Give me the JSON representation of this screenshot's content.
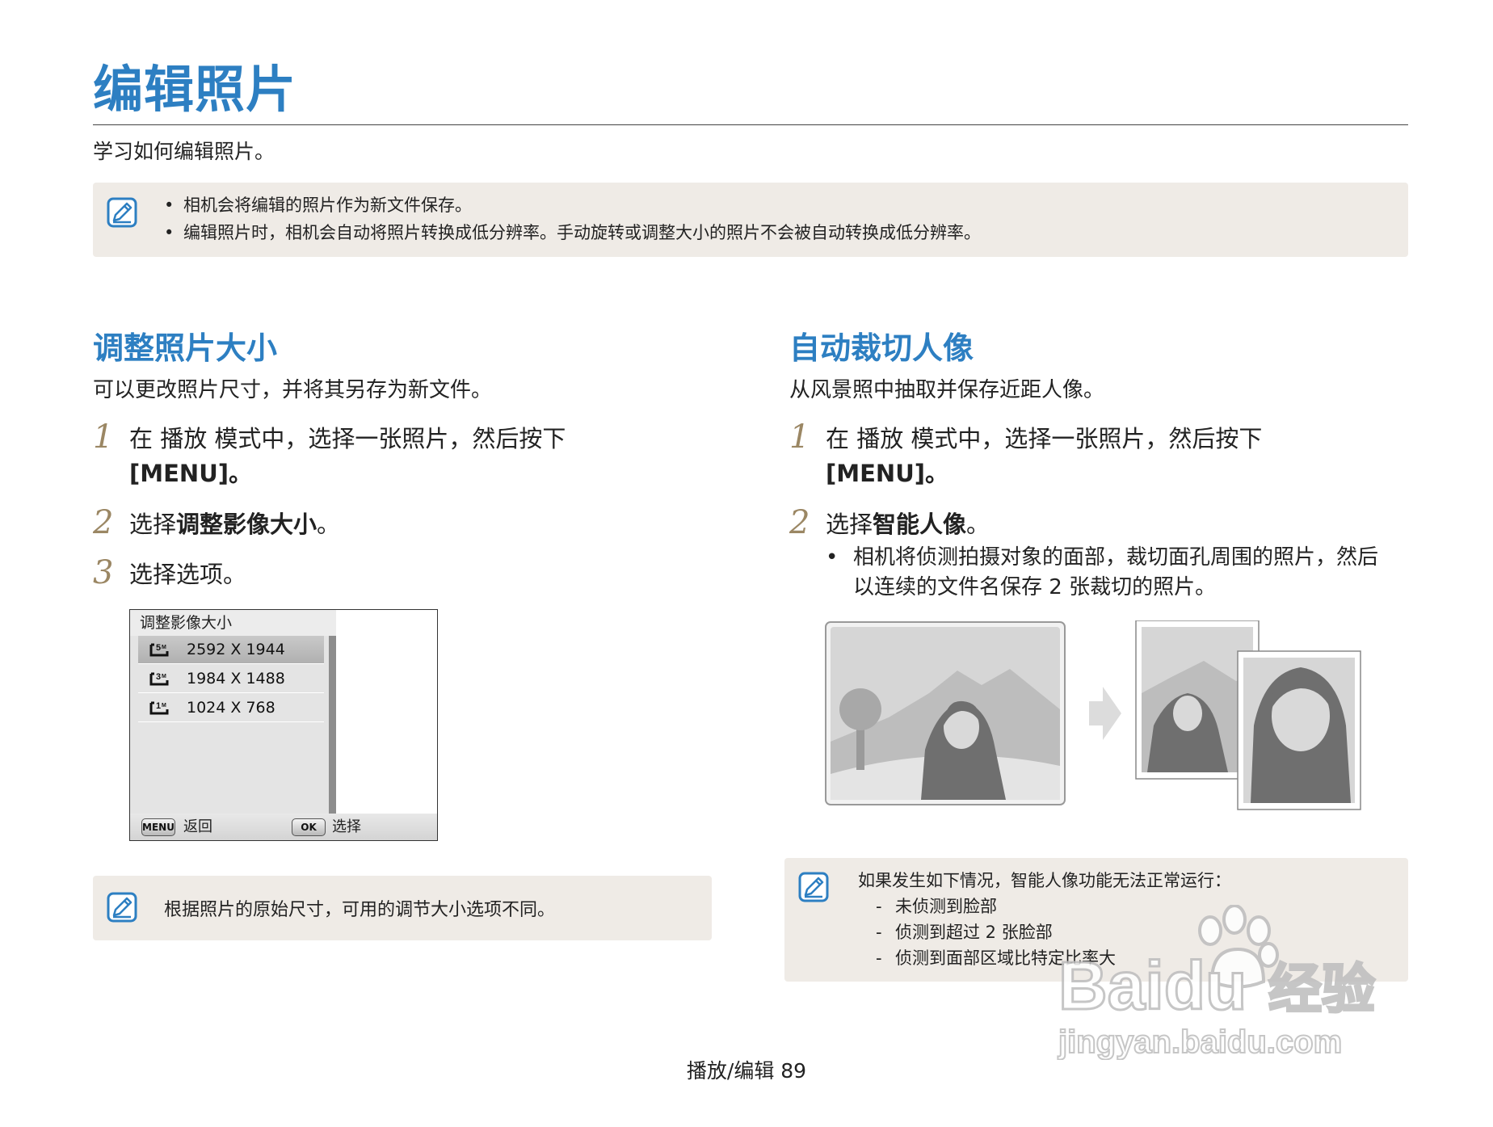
{
  "page": {
    "title": "编辑照片",
    "subtitle": "学习如何编辑照片。",
    "footer": "播放/编辑  89"
  },
  "top_note": {
    "icon": "note-pencil-icon",
    "items": [
      "相机会将编辑的照片作为新文件保存。",
      "编辑照片时，相机会自动将照片转换成低分辨率。手动旋转或调整大小的照片不会被自动转换成低分辨率。"
    ]
  },
  "resize_section": {
    "title": "调整照片大小",
    "desc": "可以更改照片尺寸，并将其另存为新文件。",
    "steps": [
      {
        "num": "1",
        "line1": "在  播放  模式中，选择一张照片，然后按下",
        "line2": "[MENU]。"
      },
      {
        "num": "2",
        "pre": "选择",
        "bold": "调整影像大小",
        "post": "。"
      },
      {
        "num": "3",
        "text": "选择选项。"
      }
    ],
    "screen": {
      "header": "调整影像大小",
      "options": [
        {
          "icon": "5m-size-icon",
          "label": "2592 X 1944",
          "selected": true
        },
        {
          "icon": "3m-size-icon",
          "label": "1984 X 1488",
          "selected": false
        },
        {
          "icon": "1m-size-icon",
          "label": "1024 X 768",
          "selected": false
        }
      ],
      "footer": {
        "menu_key": "MENU",
        "menu_label": "返回",
        "ok_key": "OK",
        "ok_label": "选择"
      }
    },
    "note": "根据照片的原始尺寸，可用的调节大小选项不同。"
  },
  "portrait_section": {
    "title": "自动裁切人像",
    "desc": "从风景照中抽取并保存近距人像。",
    "steps": [
      {
        "num": "1",
        "line1": "在  播放  模式中，选择一张照片，然后按下",
        "line2": "[MENU]。"
      },
      {
        "num": "2",
        "pre": "选择",
        "bold": "智能人像",
        "post": "。"
      }
    ],
    "bullet_lines": [
      "相机将侦测拍摄对象的面部，裁切面孔周围的照片，然后",
      "以连续的文件名保存 2 张裁切的照片。"
    ],
    "note": {
      "intro": "如果发生如下情况，智能人像功能无法正常运行：",
      "items": [
        "未侦测到脸部",
        "侦测到超过 2 张脸部",
        "侦测到面部区域比特定比率大"
      ]
    }
  },
  "watermark": {
    "brand": "Bai",
    "brand2": "du",
    "cn": "经验",
    "url": "jingyan.baidu.com"
  },
  "colors": {
    "accent": "#2d7fc2",
    "step_number": "#9b8764",
    "note_bg": "#efebe6"
  }
}
